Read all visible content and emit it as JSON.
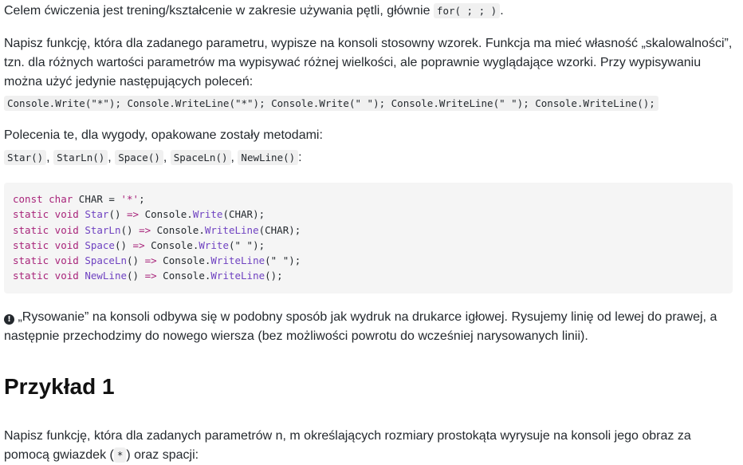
{
  "intro": {
    "text": "Celem ćwiczenia jest trening/kształcenie w zakresie używania pętli, głównie",
    "code": "for( ; ; )",
    "end": "."
  },
  "task": {
    "text": "Napisz funkcję, która dla zadanego parametru, wypisze na konsoli stosowny wzorek. Funkcja ma mieć własność „skalowalności”, tzn. dla różnych wartości parametrów ma wypisywać różnej wielkości, ale poprawnie wyglądające wzorki. Przy wypisywaniu można użyć jedynie następujących poleceń:",
    "commands": "Console.Write(\"*\"); Console.WriteLine(\"*\"); Console.Write(\" \"); Console.WriteLine(\" \"); Console.WriteLine();"
  },
  "wrappers": {
    "text": "Polecenia te, dla wygody, opakowane zostały metodami:",
    "methods": [
      "Star()",
      "StarLn()",
      "Space()",
      "SpaceLn()",
      "NewLine()"
    ],
    "separator": ",",
    "end": ":"
  },
  "code_block": {
    "lines": [
      [
        {
          "t": "const char",
          "c": "kw"
        },
        {
          "t": " CHAR = "
        },
        {
          "t": "'*'",
          "c": "str"
        },
        {
          "t": ";"
        }
      ],
      [
        {
          "t": "static void",
          "c": "kw"
        },
        {
          "t": " "
        },
        {
          "t": "Star",
          "c": "fn"
        },
        {
          "t": "() "
        },
        {
          "t": "=>",
          "c": "op"
        },
        {
          "t": " Console."
        },
        {
          "t": "Write",
          "c": "fn"
        },
        {
          "t": "(CHAR);"
        }
      ],
      [
        {
          "t": "static void",
          "c": "kw"
        },
        {
          "t": " "
        },
        {
          "t": "StarLn",
          "c": "fn"
        },
        {
          "t": "() "
        },
        {
          "t": "=>",
          "c": "op"
        },
        {
          "t": " Console."
        },
        {
          "t": "WriteLine",
          "c": "fn"
        },
        {
          "t": "(CHAR);"
        }
      ],
      [
        {
          "t": "static void",
          "c": "kw"
        },
        {
          "t": " "
        },
        {
          "t": "Space",
          "c": "fn"
        },
        {
          "t": "() "
        },
        {
          "t": "=>",
          "c": "op"
        },
        {
          "t": " Console."
        },
        {
          "t": "Write",
          "c": "fn"
        },
        {
          "t": "(\" \");"
        }
      ],
      [
        {
          "t": "static void",
          "c": "kw"
        },
        {
          "t": " "
        },
        {
          "t": "SpaceLn",
          "c": "fn"
        },
        {
          "t": "() "
        },
        {
          "t": "=>",
          "c": "op"
        },
        {
          "t": " Console."
        },
        {
          "t": "WriteLine",
          "c": "fn"
        },
        {
          "t": "(\" \");"
        }
      ],
      [
        {
          "t": "static void",
          "c": "kw"
        },
        {
          "t": " "
        },
        {
          "t": "NewLine",
          "c": "fn"
        },
        {
          "t": "() "
        },
        {
          "t": "=>",
          "c": "op"
        },
        {
          "t": " Console."
        },
        {
          "t": "WriteLine",
          "c": "fn"
        },
        {
          "t": "();"
        }
      ]
    ]
  },
  "note": {
    "icon": "info-icon",
    "text": "„Rysowanie” na konsoli odbywa się w podobny sposób jak wydruk na drukarce igłowej. Rysujemy linię od lewej do prawej, a następnie przechodzimy do nowego wiersza (bez możliwości powrotu do wcześniej narysowanych linii)."
  },
  "example": {
    "heading": "Przykład 1",
    "text": "Napisz funkcję, która dla zadanych parametrów n, m określających rozmiary prostokąta wyrysuje na konsoli jego obraz za pomocą gwiazdek (",
    "code": "*",
    "end": ") oraz spacji:"
  }
}
